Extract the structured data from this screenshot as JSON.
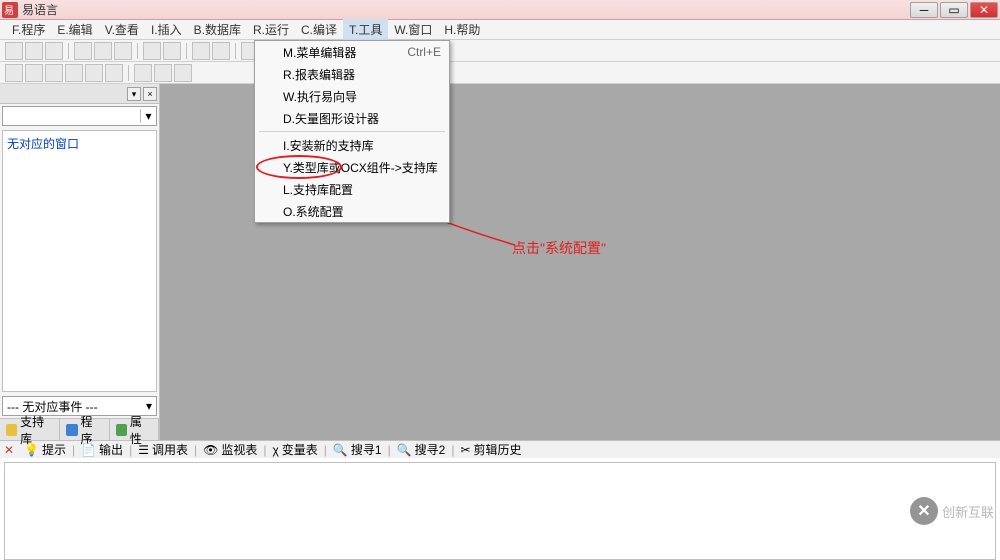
{
  "titlebar": {
    "title": "易语言"
  },
  "menubar": {
    "items": [
      {
        "label": "F.程序"
      },
      {
        "label": "E.编辑"
      },
      {
        "label": "V.查看"
      },
      {
        "label": "I.插入"
      },
      {
        "label": "B.数据库"
      },
      {
        "label": "R.运行"
      },
      {
        "label": "C.编译"
      },
      {
        "label": "T.工具"
      },
      {
        "label": "W.窗口"
      },
      {
        "label": "H.帮助"
      }
    ]
  },
  "dropdown": {
    "items": [
      {
        "label": "M.菜单编辑器",
        "shortcut": "Ctrl+E"
      },
      {
        "label": "R.报表编辑器"
      },
      {
        "label": "W.执行易向导"
      },
      {
        "label": "D.矢量图形设计器"
      },
      {
        "sep": true
      },
      {
        "label": "I.安装新的支持库"
      },
      {
        "label": "Y.类型库或OCX组件->支持库"
      },
      {
        "label": "L.支持库配置"
      },
      {
        "label": "O.系统配置"
      }
    ]
  },
  "sidebar": {
    "content_text": "无对应的窗口",
    "footer_dropdown": "--- 无对应事件 ---",
    "tabs": [
      {
        "label": "支持库"
      },
      {
        "label": "程序"
      },
      {
        "label": "属性"
      }
    ]
  },
  "bottom_tabs": {
    "items": [
      {
        "icon": "hint",
        "label": "提示"
      },
      {
        "icon": "output",
        "label": "输出"
      },
      {
        "icon": "callstack",
        "label": "调用表"
      },
      {
        "icon": "watch",
        "label": "监视表"
      },
      {
        "icon": "var",
        "label": "变量表"
      },
      {
        "icon": "search",
        "label": "搜寻1"
      },
      {
        "icon": "search",
        "label": "搜寻2"
      },
      {
        "icon": "clip",
        "label": "剪辑历史"
      }
    ]
  },
  "annotation": {
    "text": "点击\"系统配置\""
  },
  "watermark": {
    "text": "创新互联"
  }
}
